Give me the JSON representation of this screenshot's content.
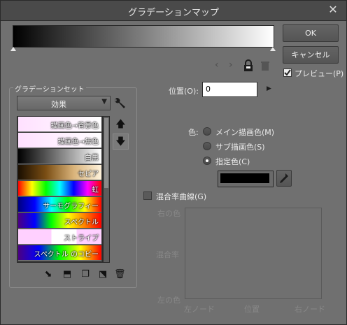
{
  "window": {
    "title": "グラデーションマップ",
    "close_glyph": "✕",
    "accent_colors": [
      "#2aa43a",
      "#d82a6f"
    ]
  },
  "gradient": {
    "start_color": "#000000",
    "end_color": "#ffffff"
  },
  "buttons": {
    "ok": "OK",
    "cancel": "キャンセル",
    "preview_label": "プレビュー(P)",
    "preview_checked": true
  },
  "nav": {
    "prev": "‹",
    "next": "›"
  },
  "sets": {
    "group_label": "グラデーションセット",
    "dropdown_value": "効果",
    "items": [
      {
        "name": "描画色→背景色",
        "gradient": "linear-gradient(to right,#ffe0ff,#ffffff)"
      },
      {
        "name": "描画色→無色",
        "gradient": "linear-gradient(to right,#ffe0ff,#ffffff)"
      },
      {
        "name": "白黒",
        "gradient": "linear-gradient(to right,#000,#fff)"
      },
      {
        "name": "セピア",
        "gradient": "linear-gradient(to right,#1a0e00,#7a4e14,#d9b37a,#fff3dc)"
      },
      {
        "name": "虹",
        "gradient": "linear-gradient(to right,#ff0000,#ffff00,#00ff00,#00ffff,#0000ff,#ff00ff,#ff0000)"
      },
      {
        "name": "サーモグラフィー",
        "gradient": "linear-gradient(to right,#000080,#0000ff,#00ffff,#00ff00,#ffff00,#ff0000)"
      },
      {
        "name": "スペクトル",
        "gradient": "linear-gradient(to right,#4b0082,#0000ff,#00ff00,#ffff00,#ff7f00,#ff0000)"
      },
      {
        "name": "ストライプ",
        "gradient": "linear-gradient(to right,#ffd0ff 0%,#ffd0ff 40%,#ffffff 40%,#ffffff 70%,#ffd0ff 70%)"
      },
      {
        "name": "スペクトル のコピー",
        "gradient": "linear-gradient(to right,#4b0082,#0000ff,#00ff00,#ffff00,#ff0000)"
      }
    ]
  },
  "position": {
    "label": "位置(O):",
    "value": "0"
  },
  "color": {
    "label": "色:",
    "options": [
      "メイン描画色(M)",
      "サブ描画色(S)",
      "指定色(C)"
    ],
    "selected_index": 2,
    "swatch": "#000000"
  },
  "blend": {
    "checkbox_label": "混合率曲線(G)",
    "checked": false,
    "y_top": "右の色",
    "y_mid": "混合率",
    "y_bottom": "左の色",
    "x_left": "左ノード",
    "x_mid": "位置",
    "x_right": "右ノード"
  }
}
